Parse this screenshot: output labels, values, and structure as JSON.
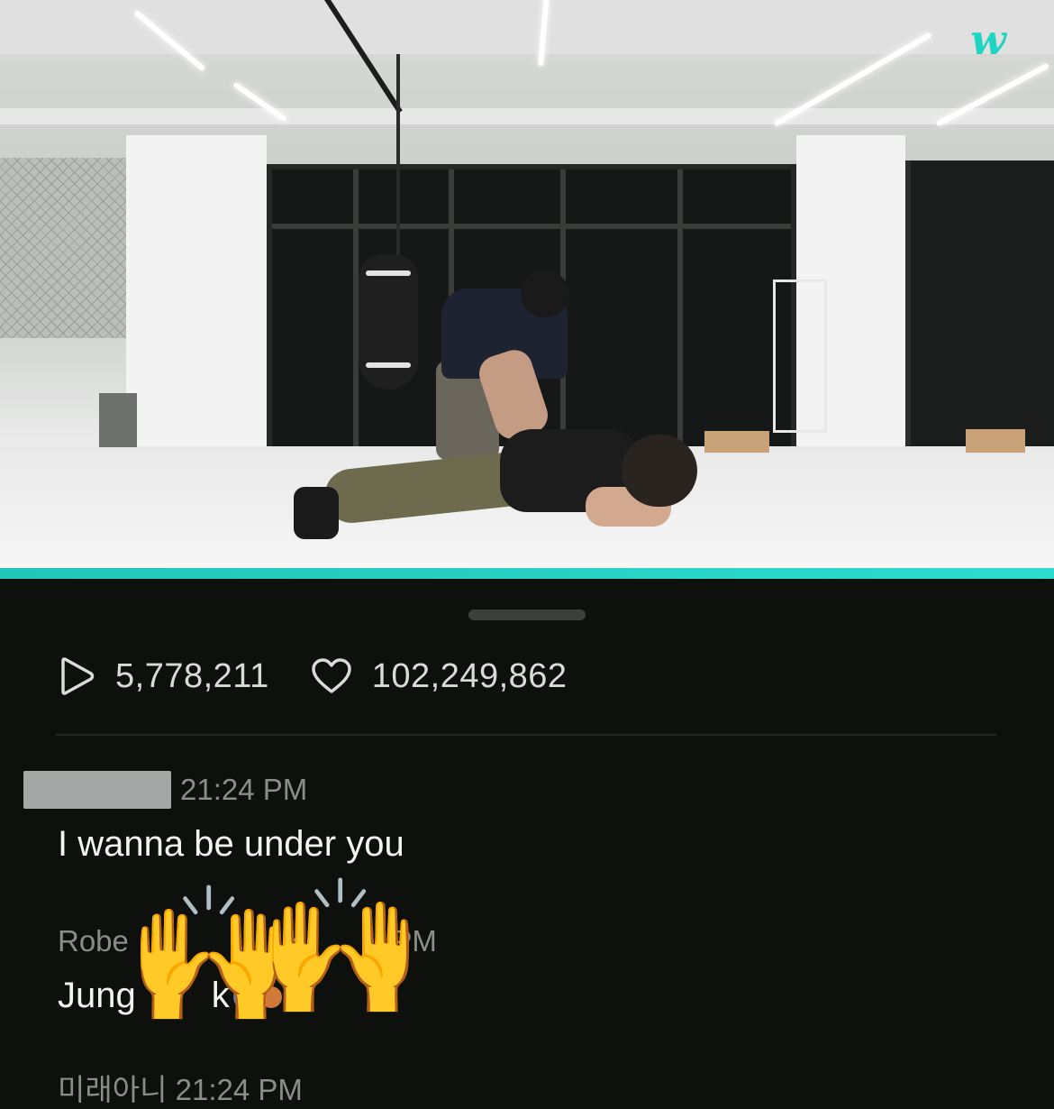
{
  "app": {
    "logo_text": "w",
    "accent_color": "#20d4c2"
  },
  "video": {
    "progress": 1.0
  },
  "stats": {
    "plays": {
      "icon": "play-icon",
      "value": "5,778,211"
    },
    "likes": {
      "icon": "heart-icon",
      "value": "102,249,862"
    }
  },
  "comments": [
    {
      "name": "",
      "time": "21:24 PM",
      "text": "I wanna be under you"
    },
    {
      "name": "Robe",
      "name_tail": "k",
      "time": "PM",
      "text": "Jung",
      "text_tail": "k"
    }
  ],
  "overlay": {
    "hand_emoji": "🙌"
  },
  "partial_next_comment": {
    "text": "미래아니 21:24 PM"
  }
}
